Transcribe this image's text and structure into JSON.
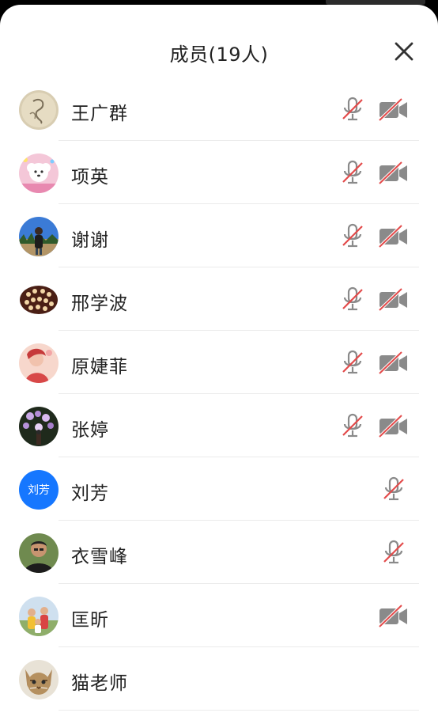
{
  "header": {
    "title": "成员(19人)"
  },
  "colors": {
    "muted_slash": "#e34b4b",
    "icon_gray": "#8a8a8a",
    "text_avatar_bg": "#1677ff"
  },
  "members": [
    {
      "name": "王广群",
      "avatar": "photo-sketch",
      "mic_muted": true,
      "camera_off": true
    },
    {
      "name": "项英",
      "avatar": "photo-puppy",
      "mic_muted": true,
      "camera_off": true
    },
    {
      "name": "谢谢",
      "avatar": "photo-person-outdoor",
      "mic_muted": true,
      "camera_off": true
    },
    {
      "name": "邢学波",
      "avatar": "photo-pattern",
      "mic_muted": true,
      "camera_off": true
    },
    {
      "name": "原婕菲",
      "avatar": "photo-illustration",
      "mic_muted": true,
      "camera_off": true
    },
    {
      "name": "张婷",
      "avatar": "photo-flowers",
      "mic_muted": true,
      "camera_off": true
    },
    {
      "name": "刘芳",
      "avatar_text": "刘芳",
      "mic_muted": true,
      "camera_off": null
    },
    {
      "name": "衣雪峰",
      "avatar": "photo-man",
      "mic_muted": true,
      "camera_off": null
    },
    {
      "name": "匡昕",
      "avatar": "photo-family",
      "mic_muted": null,
      "camera_off": true
    },
    {
      "name": "猫老师",
      "avatar": "photo-cat",
      "mic_muted": null,
      "camera_off": null
    }
  ]
}
